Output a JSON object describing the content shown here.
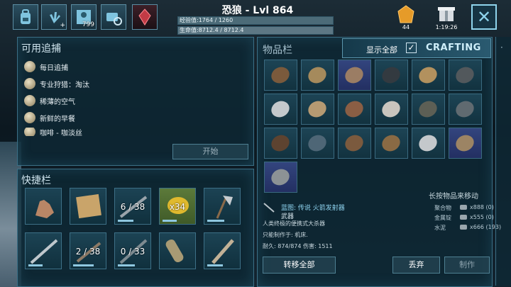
{
  "top_bar": {
    "icons": [
      "backpack-icon",
      "footprint-icon",
      "profile-icon",
      "camera-settings-icon",
      "crystal-icon"
    ],
    "profile_count": "799",
    "title": "恐狼 - Lvl 864",
    "xp_text": "经验值:1764 / 1260",
    "hp_text": "生命值:8712.4 / 8712.4",
    "amber_count": "44",
    "gift_timer": "1:19:26",
    "close_label": "✕"
  },
  "tracking": {
    "title": "可用追捕",
    "items": [
      {
        "label": "每日追捕",
        "icon": "calendar-icon"
      },
      {
        "label": "专业狩猎：淘汰",
        "icon": "skull-icon"
      },
      {
        "label": "稀薄的空气",
        "icon": "air-icon"
      },
      {
        "label": "新鲜的早餐",
        "icon": "egg-icon"
      },
      {
        "label": "咖啡 - 咖淡丝",
        "icon": "egg-icon"
      }
    ],
    "start_label": "开始"
  },
  "hotbar": {
    "title": "快捷栏",
    "slots": [
      {
        "icon": "hand-icon",
        "qty": "",
        "durability": null
      },
      {
        "icon": "map-icon",
        "qty": "",
        "durability": null
      },
      {
        "icon": "shotgun-icon",
        "qty": "6 / 38",
        "durability": 0.55
      },
      {
        "icon": "lemon-icon",
        "qty": "x34",
        "durability": 0.5
      },
      {
        "icon": "hatchet-icon",
        "qty": "",
        "durability": 0.6
      },
      {
        "icon": "machete-icon",
        "qty": "",
        "durability": 0.5
      },
      {
        "icon": "pistol-icon",
        "qty": "2 / 38",
        "durability": 0.7
      },
      {
        "icon": "rifle-icon",
        "qty": "0 / 33",
        "durability": 0.6
      },
      {
        "icon": "scroll-icon",
        "qty": "",
        "durability": null
      },
      {
        "icon": "spear-icon",
        "qty": "",
        "durability": 0.55
      }
    ]
  },
  "inventory": {
    "title": "物品栏",
    "show_all_label": "显示全部",
    "crafting_tab": "CRAFTING",
    "hint": "长按物品来移动",
    "item_icons": [
      "saddle-icon",
      "cloth-shirt-icon",
      "gloves-icon",
      "flashlight-icon",
      "flak-chest-icon",
      "rifle-scope-icon",
      "hatchet-icon",
      "hat-icon",
      "spider-icon",
      "metal-sign-icon",
      "sniper-rifle-icon",
      "toolbox-icon",
      "whip-icon",
      "tarp-icon",
      "creature-icon",
      "box-icon",
      "flak-legs-icon",
      "boots-icon",
      "rocket-launcher-icon"
    ],
    "blue_slots": [
      2,
      17,
      18
    ],
    "detail": {
      "name": "蓝图: 传说 火箭发射器",
      "category": "武器",
      "description": "人类终极的便携式大杀器",
      "craft_in": "只能制作于: 机床.",
      "stats": "耐久: 874/874 伤害: 1511"
    },
    "materials": [
      {
        "name": "聚合物",
        "amount": "x888 (0)"
      },
      {
        "name": "金属锭",
        "amount": "x555 (0)"
      },
      {
        "name": "水泥",
        "amount": "x666 (193)"
      }
    ],
    "transfer_all_label": "转移全部",
    "drop_label": "丢弃",
    "craft_label": "制作"
  },
  "colors": {
    "accent": "#3b6f86",
    "xp_bar": "#4c6b78",
    "hp_bar": "#5d7784",
    "blue_slot": "#2d3d74"
  }
}
